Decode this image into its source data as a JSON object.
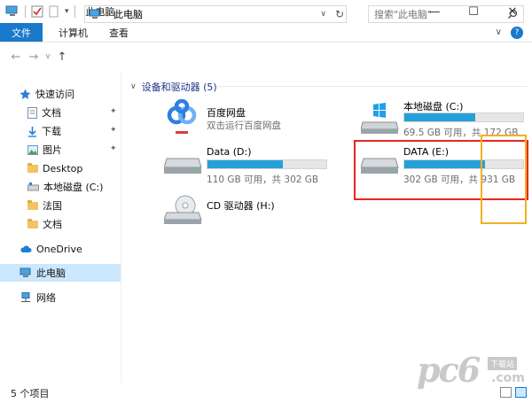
{
  "window": {
    "title": "此电脑",
    "controls": {
      "minimize": "—",
      "maximize": "☐",
      "close": "✕"
    }
  },
  "ribbon": {
    "tabs": [
      {
        "label": "文件",
        "active": true
      },
      {
        "label": "计算机"
      },
      {
        "label": "查看"
      }
    ],
    "collapse_glyph": "∨",
    "help_glyph": "?"
  },
  "address": {
    "path": "此电脑",
    "search_placeholder": "搜索\"此电脑\""
  },
  "navigation": {
    "items": [
      {
        "label": "快速访问",
        "icon": "star-icon"
      },
      {
        "label": "文档",
        "icon": "document-icon",
        "pinned": true
      },
      {
        "label": "下载",
        "icon": "download-icon",
        "pinned": true
      },
      {
        "label": "图片",
        "icon": "picture-icon",
        "pinned": true
      },
      {
        "label": "Desktop",
        "icon": "folder-icon"
      },
      {
        "label": "本地磁盘 (C:)",
        "icon": "drive-icon"
      },
      {
        "label": "法国",
        "icon": "folder-icon"
      },
      {
        "label": "文档",
        "icon": "folder-icon"
      },
      {
        "label": "OneDrive",
        "icon": "cloud-icon"
      },
      {
        "label": "此电脑",
        "icon": "computer-icon",
        "selected": true
      },
      {
        "label": "网络",
        "icon": "network-icon"
      }
    ],
    "pin_glyph": "📌"
  },
  "content": {
    "group_header": "设备和驱动器 (5)",
    "tiles": [
      {
        "name": "百度网盘",
        "subtitle": "双击运行百度网盘",
        "icon": "baidu-netdisk-icon"
      },
      {
        "name": "本地磁盘 (C:)",
        "subtitle": "69.5 GB 可用，共 172 GB",
        "icon": "windows-drive-icon",
        "used_fraction": 0.596
      },
      {
        "name": "Data (D:)",
        "subtitle": "110 GB 可用，共 302 GB",
        "icon": "hard-drive-icon",
        "used_fraction": 0.636
      },
      {
        "name": "DATA (E:)",
        "subtitle": "302 GB 可用，共 931 GB",
        "icon": "hard-drive-icon",
        "used_fraction": 0.676
      },
      {
        "name": "CD 驱动器 (H:)",
        "subtitle": "",
        "icon": "cd-drive-icon"
      }
    ]
  },
  "status": {
    "item_count": "5 个项目"
  },
  "watermark": {
    "big": "pc6",
    "small": "下载站",
    "com": ".com"
  },
  "colors": {
    "accent": "#1979ca",
    "bar_fill": "#26a0da",
    "red_box": "#e8271f",
    "orange_box": "#f2b021"
  }
}
